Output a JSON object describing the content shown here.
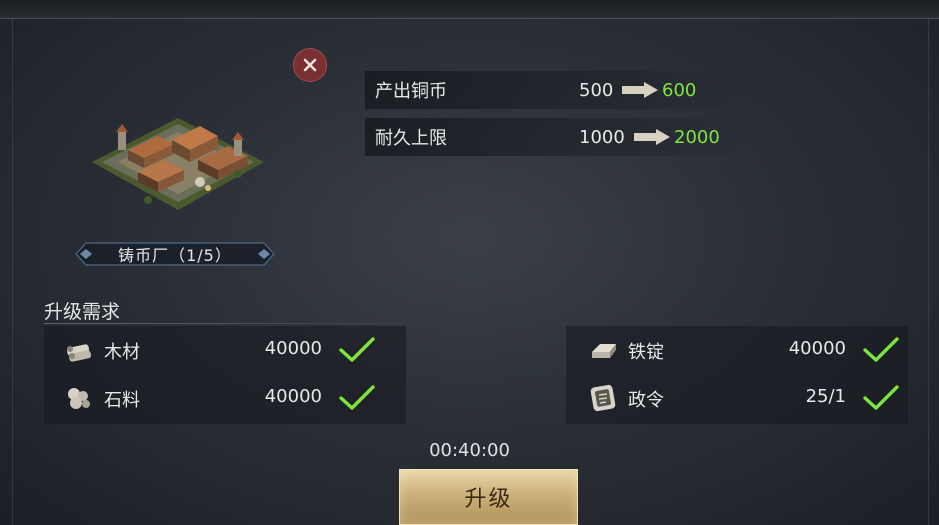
{
  "building": {
    "name": "铸币厂（1/5）"
  },
  "stats": [
    {
      "label": "产出铜币",
      "old": "500",
      "new": "600"
    },
    {
      "label": "耐久上限",
      "old": "1000",
      "new": "2000"
    }
  ],
  "requirements": {
    "title": "升级需求",
    "items": [
      {
        "icon": "wood-icon",
        "name": "木材",
        "amount": "40000",
        "met": true
      },
      {
        "icon": "iron-ingot-icon",
        "name": "铁锭",
        "amount": "40000",
        "met": true
      },
      {
        "icon": "stone-icon",
        "name": "石料",
        "amount": "40000",
        "met": true
      },
      {
        "icon": "decree-icon",
        "name": "政令",
        "amount": "25/1",
        "met": true
      }
    ]
  },
  "timer": "00:40:00",
  "upgrade_button": "升级",
  "colors": {
    "increase": "#7ee53e",
    "check": "#7ee53e",
    "close": "#7a2f33"
  }
}
